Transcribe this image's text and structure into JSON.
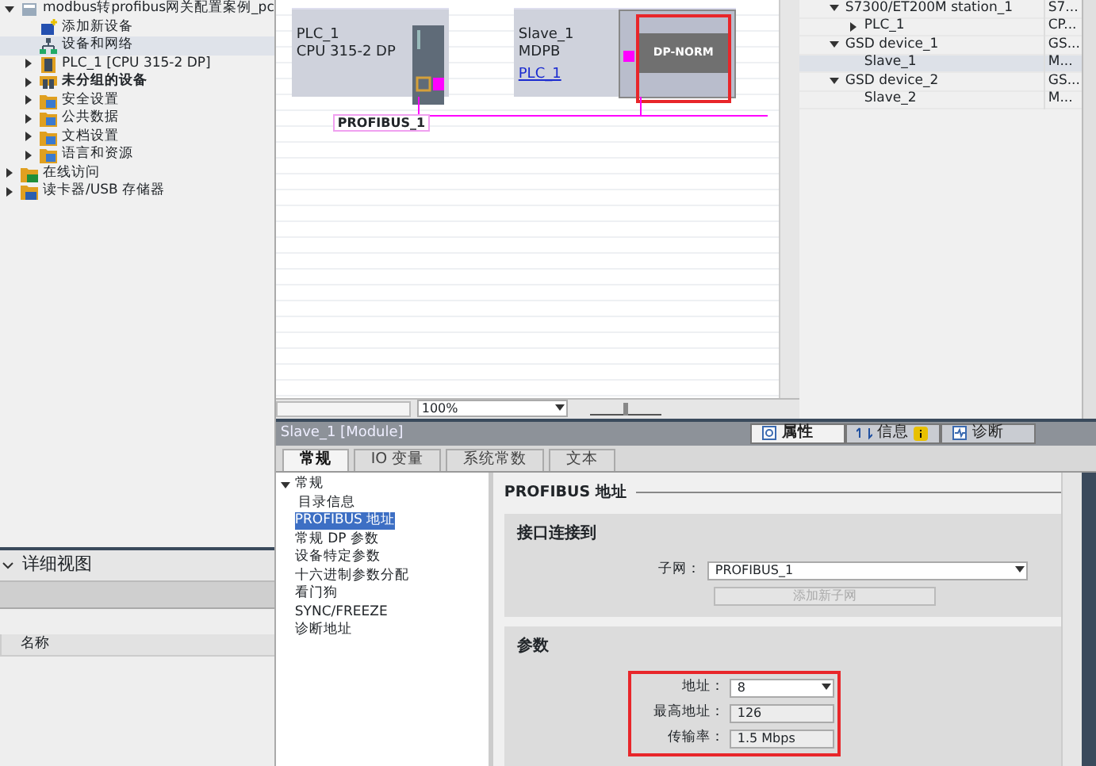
{
  "project_tree": {
    "items": [
      {
        "label": "modbus转profibus网关配置案例_pc",
        "kind": "project",
        "expanded": true,
        "selected": false,
        "children": [
          {
            "label": "添加新设备",
            "kind": "add",
            "selected": false
          },
          {
            "label": "设备和网络",
            "kind": "network",
            "selected": true
          },
          {
            "label": "PLC_1 [CPU 315-2 DP]",
            "kind": "cpu",
            "expanded": false,
            "selected": false
          },
          {
            "label": "未分组的设备",
            "kind": "devices",
            "expanded": false,
            "selected": false,
            "emphasized": true
          },
          {
            "label": "安全设置",
            "kind": "folder",
            "expanded": false,
            "selected": false
          },
          {
            "label": "公共数据",
            "kind": "folder",
            "expanded": false,
            "selected": false
          },
          {
            "label": "文档设置",
            "kind": "folder",
            "expanded": false,
            "selected": false
          },
          {
            "label": "语言和资源",
            "kind": "folder",
            "expanded": false,
            "selected": false
          }
        ]
      },
      {
        "label": "在线访问",
        "kind": "online",
        "expanded": false,
        "selected": false
      },
      {
        "label": "读卡器/USB 存储器",
        "kind": "card",
        "expanded": false,
        "selected": false
      }
    ]
  },
  "detail_view": {
    "title": "详细视图",
    "columns": [
      "名称"
    ]
  },
  "network_view": {
    "devices": [
      {
        "name": "PLC_1",
        "type": "CPU 315-2 DP",
        "kind": "cpu"
      },
      {
        "name": "Slave_1",
        "type": "MDPB",
        "link": "PLC_1",
        "kind": "slave",
        "module": "DP-NORM",
        "highlighted": true
      }
    ],
    "subnet": "PROFIBUS_1",
    "zoom": "100%",
    "zoom_slider": {
      "level": 0.5
    }
  },
  "device_table": {
    "rows": [
      {
        "name": "S7300/ET200M station_1",
        "column_2": "S7...",
        "expanded": true,
        "selected": false,
        "children": [
          {
            "name": "PLC_1",
            "column_2": "CP...",
            "expanded": false,
            "selected": false
          }
        ]
      },
      {
        "name": "GSD device_1",
        "column_2": "GS...",
        "expanded": true,
        "selected": false,
        "children": [
          {
            "name": "Slave_1",
            "column_2": "M...",
            "selected": true
          }
        ]
      },
      {
        "name": "GSD device_2",
        "column_2": "GS...",
        "expanded": true,
        "selected": false,
        "children": [
          {
            "name": "Slave_2",
            "column_2": "M...",
            "selected": false
          }
        ]
      }
    ]
  },
  "inspector": {
    "title": "Slave_1 [Module]",
    "view_tabs": [
      {
        "label": "属性",
        "selected": true
      },
      {
        "label": "信息",
        "selected": false,
        "alert": true
      },
      {
        "label": "诊断",
        "selected": false
      }
    ],
    "tabs": [
      {
        "label": "常规",
        "selected": true
      },
      {
        "label": "IO 变量",
        "selected": false
      },
      {
        "label": "系统常数",
        "selected": false
      },
      {
        "label": "文本",
        "selected": false
      }
    ],
    "nav": [
      {
        "label": "常规",
        "expanded": true,
        "selected": false,
        "children": [
          {
            "label": "目录信息",
            "selected": false
          }
        ]
      },
      {
        "label": "PROFIBUS 地址",
        "selected": true
      },
      {
        "label": "常规 DP 参数",
        "selected": false
      },
      {
        "label": "设备特定参数",
        "selected": false
      },
      {
        "label": "十六进制参数分配",
        "selected": false
      },
      {
        "label": "看门狗",
        "selected": false
      },
      {
        "label": "SYNC/FREEZE",
        "selected": false
      },
      {
        "label": "诊断地址",
        "selected": false
      }
    ],
    "heading": "PROFIBUS 地址",
    "sections": [
      {
        "title": "接口连接到",
        "fields": [
          {
            "label": "子网：",
            "value": "PROFIBUS_1",
            "kind": "dropdown"
          }
        ],
        "button": {
          "label": "添加新子网",
          "disabled": true
        }
      },
      {
        "title": "参数",
        "highlighted": true,
        "fields": [
          {
            "label": "地址：",
            "value": "8",
            "kind": "dropdown"
          },
          {
            "label": "最高地址：",
            "value": "126",
            "kind": "readonly"
          },
          {
            "label": "传输率：",
            "value": "1.5 Mbps",
            "kind": "readonly"
          }
        ]
      }
    ]
  }
}
